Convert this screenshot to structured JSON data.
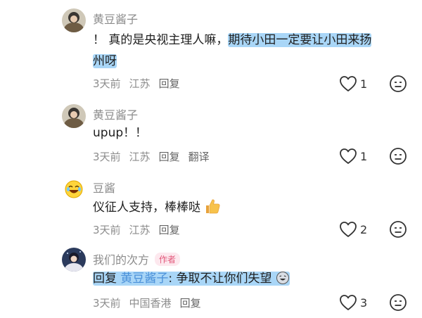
{
  "comments": [
    {
      "author": "黄豆酱子",
      "text_a": "！ 真的是央视主理人嘛，",
      "text_b": "期待小田一定要让小田来扬",
      "text_c": "州呀",
      "time": "3天前",
      "location": "江苏",
      "reply": "回复",
      "likes": "1"
    },
    {
      "author": "黄豆酱子",
      "text": "upup！！",
      "time": "3天前",
      "location": "江苏",
      "reply": "回复",
      "translate": "翻译",
      "likes": "1"
    },
    {
      "author": "豆酱",
      "text": "仪征人支持，棒棒哒",
      "time": "3天前",
      "location": "江苏",
      "reply": "回复",
      "likes": "2"
    },
    {
      "author": "我们的次方",
      "badge": "作者",
      "reply_prefix": "回复",
      "reply_target": "黄豆酱子",
      "text": ": 争取不让你们失望",
      "time": "3天前",
      "location": "中国香港",
      "reply": "回复",
      "likes": "3"
    }
  ],
  "icons": {
    "like": "heart-outline-icon",
    "dislike": "meh-face-icon",
    "thumbs": "thumbs-up-emoji",
    "laugh": "laugh-emoji"
  }
}
